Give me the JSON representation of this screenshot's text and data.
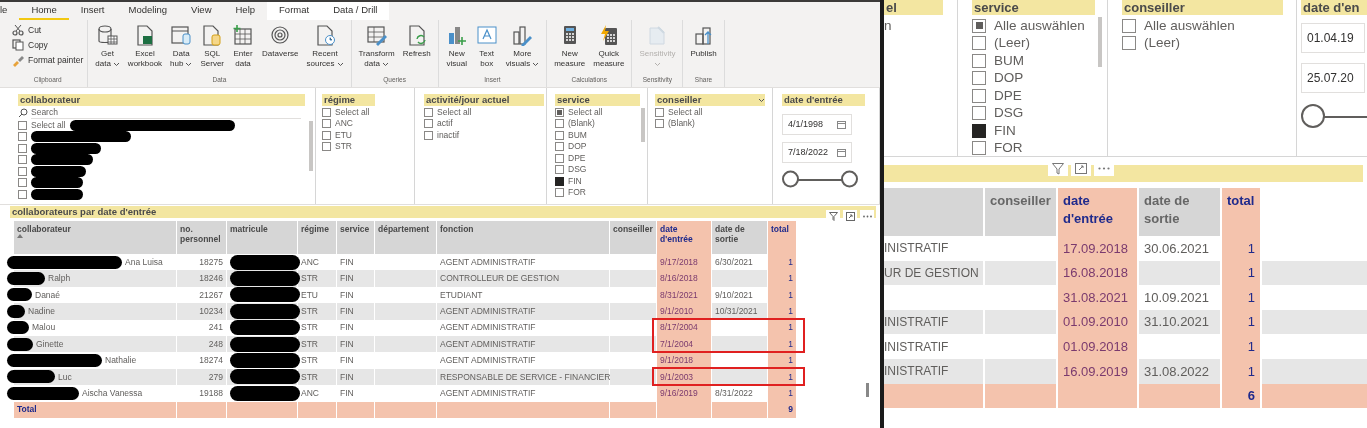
{
  "left": {
    "ribbon": {
      "tabs": [
        {
          "label": "le",
          "selected": false,
          "contextual": false
        },
        {
          "label": "Home",
          "selected": true,
          "contextual": false
        },
        {
          "label": "Insert",
          "selected": false,
          "contextual": false
        },
        {
          "label": "Modeling",
          "selected": false,
          "contextual": false
        },
        {
          "label": "View",
          "selected": false,
          "contextual": false
        },
        {
          "label": "Help",
          "selected": false,
          "contextual": false
        },
        {
          "label": "Format",
          "selected": false,
          "contextual": true
        },
        {
          "label": "Data / Drill",
          "selected": false,
          "contextual": true
        }
      ],
      "groups": [
        {
          "label": "Clipboard",
          "kind": "small",
          "buttons": [
            {
              "lines": [
                "Cut"
              ],
              "dropdown": false,
              "disabled": false
            },
            {
              "lines": [
                "Copy"
              ],
              "dropdown": false,
              "disabled": false
            },
            {
              "lines": [
                "Format painter"
              ],
              "dropdown": false,
              "disabled": false
            }
          ]
        },
        {
          "label": "Data",
          "kind": "large",
          "buttons": [
            {
              "lines": [
                "Get",
                "data"
              ],
              "dropdown": true,
              "disabled": false
            },
            {
              "lines": [
                "Excel",
                "workbook"
              ],
              "dropdown": false,
              "disabled": false
            },
            {
              "lines": [
                "Data",
                "hub"
              ],
              "dropdown": true,
              "disabled": false
            },
            {
              "lines": [
                "SQL",
                "Server"
              ],
              "dropdown": false,
              "disabled": false
            },
            {
              "lines": [
                "Enter",
                "data"
              ],
              "dropdown": false,
              "disabled": false
            },
            {
              "lines": [
                "Dataverse"
              ],
              "dropdown": false,
              "disabled": false
            },
            {
              "lines": [
                "Recent",
                "sources"
              ],
              "dropdown": true,
              "disabled": false
            }
          ]
        },
        {
          "label": "Queries",
          "kind": "large",
          "buttons": [
            {
              "lines": [
                "Transform",
                "data"
              ],
              "dropdown": true,
              "disabled": false
            },
            {
              "lines": [
                "Refresh"
              ],
              "dropdown": false,
              "disabled": false
            }
          ]
        },
        {
          "label": "Insert",
          "kind": "large",
          "buttons": [
            {
              "lines": [
                "New",
                "visual"
              ],
              "dropdown": false,
              "disabled": false
            },
            {
              "lines": [
                "Text",
                "box"
              ],
              "dropdown": false,
              "disabled": false
            },
            {
              "lines": [
                "More",
                "visuals"
              ],
              "dropdown": true,
              "disabled": false
            }
          ]
        },
        {
          "label": "Calculations",
          "kind": "large",
          "buttons": [
            {
              "lines": [
                "New",
                "measure"
              ],
              "dropdown": false,
              "disabled": false
            },
            {
              "lines": [
                "Quick",
                "measure"
              ],
              "dropdown": false,
              "disabled": false
            }
          ]
        },
        {
          "label": "Sensitivity",
          "kind": "large",
          "buttons": [
            {
              "lines": [
                "Sensitivity"
              ],
              "dropdown": true,
              "disabled": true
            }
          ]
        },
        {
          "label": "Share",
          "kind": "large",
          "buttons": [
            {
              "lines": [
                "Publish"
              ],
              "dropdown": false,
              "disabled": false
            }
          ]
        }
      ]
    },
    "slicers": [
      {
        "kind": "list",
        "title": "collaborateur",
        "search_placeholder": "Search",
        "dropdown": false,
        "items": [
          {
            "label": "Select all",
            "checked": false,
            "partial": false,
            "redacted": true
          },
          {
            "checked": false,
            "partial": false,
            "redacted": true
          },
          {
            "checked": false,
            "partial": false,
            "redacted": true
          },
          {
            "checked": false,
            "partial": false,
            "redacted": true
          },
          {
            "checked": false,
            "partial": false,
            "redacted": true
          },
          {
            "checked": false,
            "partial": false,
            "redacted": true
          },
          {
            "checked": false,
            "partial": false,
            "redacted": true
          }
        ]
      },
      {
        "kind": "list",
        "title": "régime",
        "dropdown": false,
        "items": [
          {
            "label": "Select all",
            "checked": false,
            "partial": false,
            "redacted": false
          },
          {
            "label": "ANC",
            "checked": false,
            "partial": false,
            "redacted": false
          },
          {
            "label": "ETU",
            "checked": false,
            "partial": false,
            "redacted": false
          },
          {
            "label": "STR",
            "checked": false,
            "partial": false,
            "redacted": false
          }
        ]
      },
      {
        "kind": "list",
        "title": "activité/jour actuel",
        "dropdown": false,
        "items": [
          {
            "label": "Select all",
            "checked": false,
            "partial": false,
            "redacted": false
          },
          {
            "label": "actif",
            "checked": false,
            "partial": false,
            "redacted": false
          },
          {
            "label": "inactif",
            "checked": false,
            "partial": false,
            "redacted": false
          }
        ]
      },
      {
        "kind": "list",
        "title": "service",
        "dropdown": false,
        "items": [
          {
            "label": "Select all",
            "partial": true,
            "redacted": false
          },
          {
            "label": "(Blank)",
            "checked": false,
            "partial": false,
            "redacted": false
          },
          {
            "label": "BUM",
            "checked": false,
            "partial": false,
            "redacted": false
          },
          {
            "label": "DOP",
            "checked": false,
            "partial": false,
            "redacted": false
          },
          {
            "label": "DPE",
            "checked": false,
            "partial": false,
            "redacted": false
          },
          {
            "label": "DSG",
            "checked": false,
            "partial": false,
            "redacted": false
          },
          {
            "label": "FIN",
            "checked": true,
            "partial": false,
            "redacted": false
          },
          {
            "label": "FOR",
            "checked": false,
            "partial": false,
            "redacted": false
          }
        ]
      },
      {
        "kind": "list",
        "title": "conseiller",
        "dropdown": true,
        "items": [
          {
            "label": "Select all",
            "checked": false,
            "partial": false,
            "redacted": false
          },
          {
            "label": "(Blank)",
            "checked": false,
            "partial": false,
            "redacted": false
          }
        ]
      },
      {
        "kind": "date",
        "title": "date d'entrée",
        "dropdown": false,
        "from": "4/1/1998",
        "to": "7/18/2022",
        "slider": {
          "level": 1
        }
      }
    ],
    "table": {
      "title": "collaborateurs par date d'entrée",
      "columns": [
        {
          "label": "collaborateur",
          "sorted": true,
          "accent": false
        },
        {
          "label": "no. personnel",
          "sorted": false,
          "accent": false
        },
        {
          "label": "matricule",
          "sorted": false,
          "accent": false
        },
        {
          "label": "régime",
          "sorted": false,
          "accent": false
        },
        {
          "label": "service",
          "sorted": false,
          "accent": false
        },
        {
          "label": "département",
          "sorted": false,
          "accent": false
        },
        {
          "label": "fonction",
          "sorted": false,
          "accent": false
        },
        {
          "label": "conseiller",
          "sorted": false,
          "accent": false
        },
        {
          "label": "date d'entrée",
          "sorted": false,
          "accent": true
        },
        {
          "label": "date de sortie",
          "sorted": false,
          "accent": false
        },
        {
          "label": "total",
          "sorted": false,
          "accent": true
        }
      ],
      "rows": [
        {
          "collaborateur": "Ana Luisa",
          "no_personnel": "18275",
          "regime": "ANC",
          "service": "FIN",
          "fonction": "AGENT ADMINISTRATIF",
          "date_entree": "9/17/2018",
          "date_sortie": "6/30/2021",
          "total": "1",
          "redacted": true,
          "highlighted": false
        },
        {
          "collaborateur": "Ralph",
          "no_personnel": "18246",
          "regime": "STR",
          "service": "FIN",
          "fonction": "CONTROLLEUR DE GESTION",
          "date_entree": "8/16/2018",
          "total": "1",
          "redacted": true,
          "highlighted": false
        },
        {
          "collaborateur": "Danaé",
          "no_personnel": "21267",
          "regime": "ETU",
          "service": "FIN",
          "fonction": "ETUDIANT",
          "date_entree": "8/31/2021",
          "date_sortie": "9/10/2021",
          "total": "1",
          "redacted": true,
          "highlighted": false
        },
        {
          "collaborateur": "Nadine",
          "no_personnel": "10234",
          "regime": "STR",
          "service": "FIN",
          "fonction": "AGENT ADMINISTRATIF",
          "date_entree": "9/1/2010",
          "date_sortie": "10/31/2021",
          "total": "1",
          "redacted": true,
          "highlighted": false
        },
        {
          "collaborateur": "Malou",
          "no_personnel": "241",
          "regime": "STR",
          "service": "FIN",
          "fonction": "AGENT ADMINISTRATIF",
          "date_entree": "8/17/2004",
          "total": "1",
          "redacted": true,
          "highlighted": true
        },
        {
          "collaborateur": "Ginette",
          "no_personnel": "248",
          "regime": "STR",
          "service": "FIN",
          "fonction": "AGENT ADMINISTRATIF",
          "date_entree": "7/1/2004",
          "total": "1",
          "redacted": true,
          "highlighted": true
        },
        {
          "collaborateur": "Nathalie",
          "no_personnel": "18274",
          "regime": "STR",
          "service": "FIN",
          "fonction": "AGENT ADMINISTRATIF",
          "date_entree": "9/1/2018",
          "total": "1",
          "redacted": true,
          "highlighted": false
        },
        {
          "collaborateur": "Luc",
          "no_personnel": "279",
          "regime": "STR",
          "service": "FIN",
          "fonction": "RESPONSABLE DE SERVICE - FINANCIER",
          "date_entree": "9/1/2003",
          "total": "1",
          "redacted": true,
          "highlighted": true
        },
        {
          "collaborateur": "Aischa Vanessa",
          "no_personnel": "19188",
          "regime": "ANC",
          "service": "FIN",
          "fonction": "AGENT ADMINISTRATIF",
          "date_entree": "9/16/2019",
          "date_sortie": "8/31/2022",
          "total": "1",
          "redacted": true,
          "highlighted": false
        }
      ],
      "total_row": {
        "label": "Total",
        "total": "9"
      }
    }
  },
  "right": {
    "slicers": [
      {
        "kind": "list",
        "title": "el",
        "dropdown": false,
        "items": [
          {
            "label": "n",
            "redacted": false
          }
        ]
      },
      {
        "kind": "list",
        "title": "service",
        "dropdown": false,
        "items": [
          {
            "label": "Alle auswählen",
            "partial": true,
            "redacted": false
          },
          {
            "label": "(Leer)",
            "checked": false,
            "partial": false,
            "redacted": false
          },
          {
            "label": "BUM",
            "checked": false,
            "partial": false,
            "redacted": false
          },
          {
            "label": "DOP",
            "checked": false,
            "partial": false,
            "redacted": false
          },
          {
            "label": "DPE",
            "checked": false,
            "partial": false,
            "redacted": false
          },
          {
            "label": "DSG",
            "checked": false,
            "partial": false,
            "redacted": false
          },
          {
            "label": "FIN",
            "checked": true,
            "partial": false,
            "redacted": false
          },
          {
            "label": "FOR",
            "checked": false,
            "partial": false,
            "redacted": false
          }
        ]
      },
      {
        "kind": "list",
        "title": "conseiller",
        "dropdown": false,
        "items": [
          {
            "label": "Alle auswählen",
            "checked": false,
            "partial": false,
            "redacted": false
          },
          {
            "label": "(Leer)",
            "checked": false,
            "partial": false,
            "redacted": false
          }
        ]
      },
      {
        "kind": "date",
        "title": "date d'en",
        "dropdown": false,
        "from": "01.04.19",
        "to": "25.07.20",
        "slider": {
          "level": 1
        }
      }
    ],
    "table": {
      "columns": [
        {
          "accent": false
        },
        {
          "label": "conseiller",
          "accent": false
        },
        {
          "label": "date d'entrée",
          "accent": true
        },
        {
          "label": "date de sortie",
          "accent": false
        },
        {
          "label": "total",
          "accent": true
        }
      ],
      "rows": [
        {
          "column_1": "INISTRATIF",
          "date_entree": "17.09.2018",
          "date_sortie": "30.06.2021",
          "total": "1"
        },
        {
          "column_1": "UR DE GESTION",
          "date_entree": "16.08.2018",
          "total": "1"
        },
        {
          "date_entree": "31.08.2021",
          "date_sortie": "10.09.2021",
          "total": "1"
        },
        {
          "column_1": "INISTRATIF",
          "date_entree": "01.09.2010",
          "date_sortie": "31.10.2021",
          "total": "1"
        },
        {
          "column_1": "INISTRATIF",
          "date_entree": "01.09.2018",
          "total": "1"
        },
        {
          "column_1": "INISTRATIF",
          "date_entree": "16.09.2019",
          "date_sortie": "31.08.2022",
          "total": "1"
        }
      ],
      "total_row": {
        "total": "6"
      }
    }
  }
}
